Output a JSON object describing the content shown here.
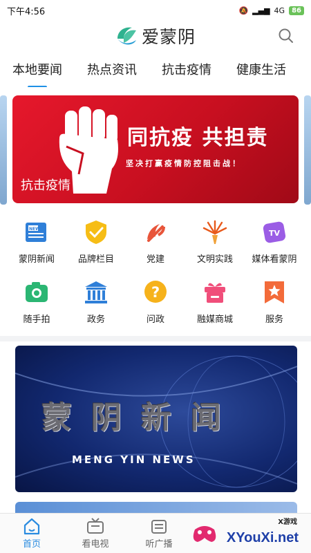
{
  "status_bar": {
    "time": "下午4:56",
    "network": "4G",
    "battery": "86"
  },
  "header": {
    "app_name": "爱蒙阴"
  },
  "tabs": [
    {
      "label": "本地要闻",
      "active": true
    },
    {
      "label": "热点资讯"
    },
    {
      "label": "抗击疫情"
    },
    {
      "label": "健康生活"
    }
  ],
  "banner": {
    "title": "同抗疫 共担责",
    "subtitle": "坚决打赢疫情防控阻击战！",
    "caption": "抗击疫情"
  },
  "grid": [
    {
      "label": "蒙阴新闻",
      "icon": "news-icon"
    },
    {
      "label": "品牌栏目",
      "icon": "shield-check-icon"
    },
    {
      "label": "党建",
      "icon": "party-emblem-icon"
    },
    {
      "label": "文明实践",
      "icon": "torch-icon"
    },
    {
      "label": "媒体看蒙阴",
      "icon": "tv-icon"
    },
    {
      "label": "随手拍",
      "icon": "camera-icon"
    },
    {
      "label": "政务",
      "icon": "government-building-icon"
    },
    {
      "label": "问政",
      "icon": "question-icon"
    },
    {
      "label": "融媒商城",
      "icon": "gift-box-icon"
    },
    {
      "label": "服务",
      "icon": "bookmark-star-icon"
    }
  ],
  "news_card": {
    "title": "蒙阴新闻",
    "subtitle": "MENG YIN NEWS"
  },
  "bottom_nav": [
    {
      "label": "首页",
      "icon": "home-icon",
      "active": true
    },
    {
      "label": "看电视",
      "icon": "tv-icon"
    },
    {
      "label": "听广播",
      "icon": "radio-icon"
    }
  ],
  "watermark": {
    "tag": "X游戏",
    "site": "XYouXi.net"
  },
  "colors": {
    "accent": "#1e90e6",
    "banner_red": "#e6182c",
    "news_blue": "#12286f"
  }
}
